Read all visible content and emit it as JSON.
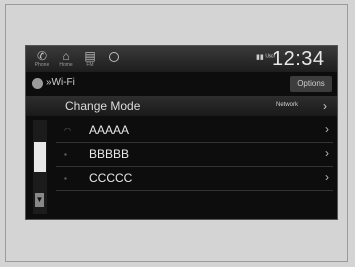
{
  "statusbar": {
    "icons": [
      {
        "name": "phone-icon",
        "label": "Phone"
      },
      {
        "name": "home-icon",
        "label": "Home"
      },
      {
        "name": "fm-icon",
        "label": "FM"
      },
      {
        "name": "circle-icon",
        "label": ""
      }
    ],
    "signal": "▮▮ ᵁˢᵉʳ",
    "clock": "12:34"
  },
  "header": {
    "breadcrumb": "»Wi-Fi",
    "options_label": "Options"
  },
  "mode_row": {
    "label": "Change Mode",
    "value": "Network"
  },
  "networks": [
    {
      "name": "AAAAA",
      "icon": "wifi-signal-icon"
    },
    {
      "name": "BBBBB",
      "icon": "lock-icon"
    },
    {
      "name": "CCCCC",
      "icon": "lock-icon"
    }
  ],
  "colors": {
    "screen_bg": "#0d0d0d",
    "text": "#e8e8e8",
    "accent": "#3d3d3d"
  }
}
